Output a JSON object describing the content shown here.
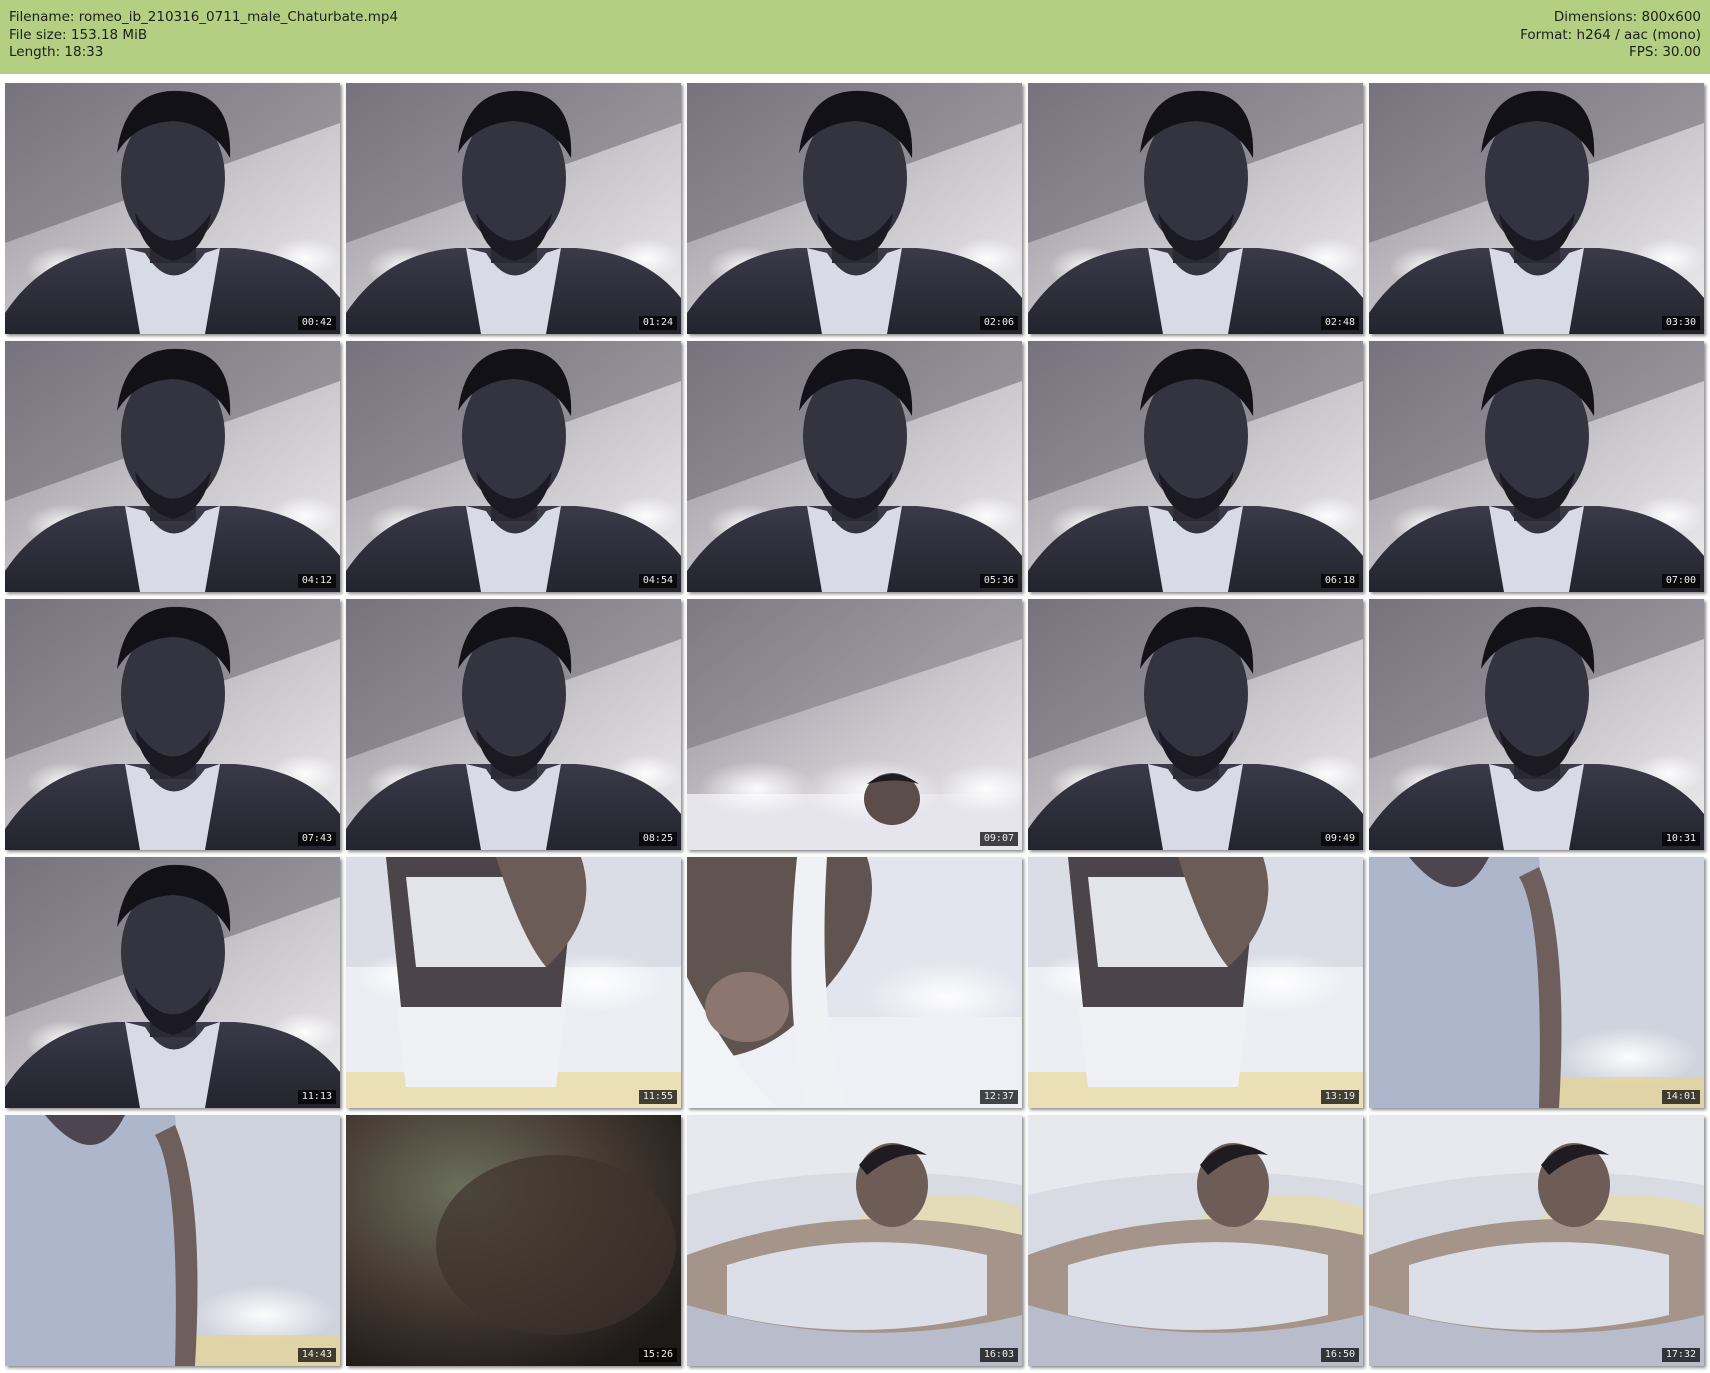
{
  "header": {
    "filename": "Filename: romeo_ib_210316_0711_male_Chaturbate.mp4",
    "filesize": "File size: 153.18 MiB",
    "length": "Length: 18:33",
    "dimensions": "Dimensions: 800x600",
    "format": "Format: h264 / aac (mono)",
    "fps": "FPS: 30.00",
    "background_color": "#b2cf82"
  },
  "thumbnails": [
    {
      "time": "00:42",
      "scene": "face"
    },
    {
      "time": "01:24",
      "scene": "face"
    },
    {
      "time": "02:06",
      "scene": "face"
    },
    {
      "time": "02:48",
      "scene": "face"
    },
    {
      "time": "03:30",
      "scene": "face"
    },
    {
      "time": "04:12",
      "scene": "face"
    },
    {
      "time": "04:54",
      "scene": "face"
    },
    {
      "time": "05:36",
      "scene": "face"
    },
    {
      "time": "06:18",
      "scene": "face"
    },
    {
      "time": "07:00",
      "scene": "face"
    },
    {
      "time": "07:43",
      "scene": "face"
    },
    {
      "time": "08:25",
      "scene": "face"
    },
    {
      "time": "09:07",
      "scene": "room-lights"
    },
    {
      "time": "09:49",
      "scene": "face"
    },
    {
      "time": "10:31",
      "scene": "face"
    },
    {
      "time": "11:13",
      "scene": "face"
    },
    {
      "time": "11:55",
      "scene": "torso-bed"
    },
    {
      "time": "12:37",
      "scene": "arm-closeup"
    },
    {
      "time": "13:19",
      "scene": "torso-bed"
    },
    {
      "time": "14:01",
      "scene": "tank-top"
    },
    {
      "time": "14:43",
      "scene": "tank-top"
    },
    {
      "time": "15:26",
      "scene": "dark-blur"
    },
    {
      "time": "16:03",
      "scene": "lying-bed"
    },
    {
      "time": "16:50",
      "scene": "lying-bed"
    },
    {
      "time": "17:32",
      "scene": "lying-bed"
    }
  ]
}
